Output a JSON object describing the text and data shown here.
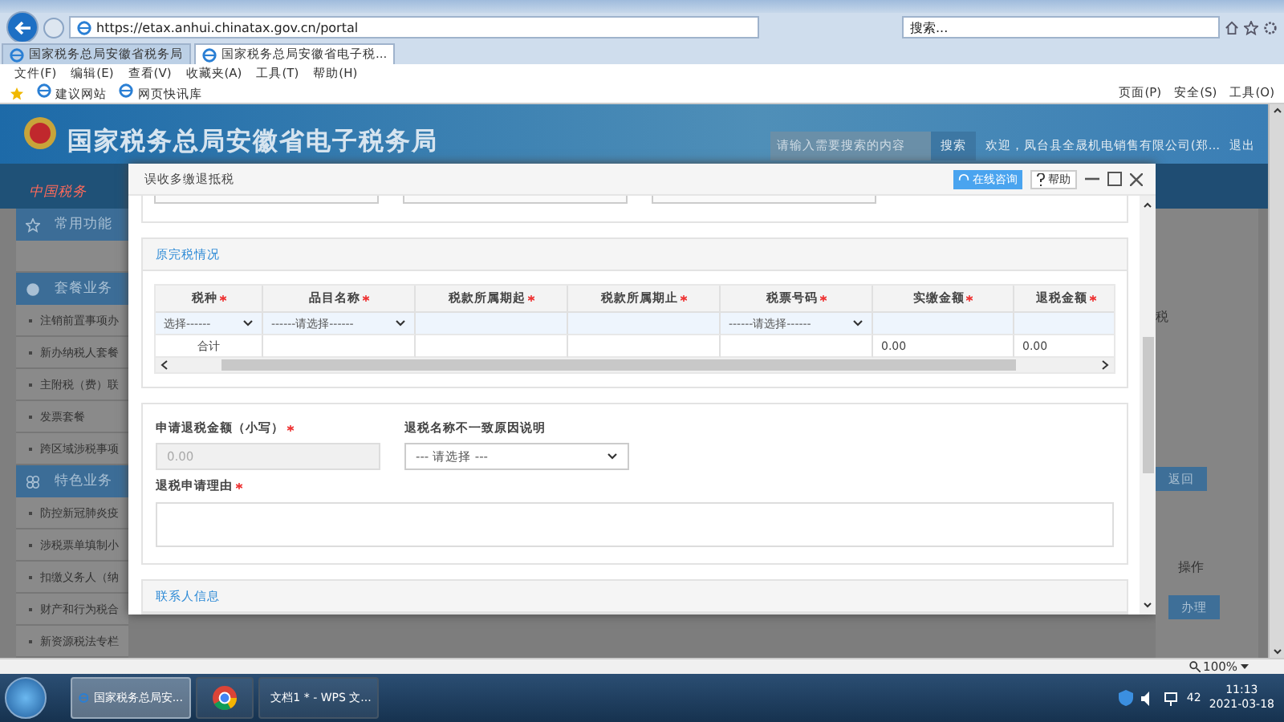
{
  "browser": {
    "url": "https://etax.anhui.chinatax.gov.cn/portal",
    "search_placeholder": "搜索...",
    "tabs": [
      {
        "label": "国家税务总局安徽省税务局",
        "selected": false
      },
      {
        "label": "国家税务总局安徽省电子税...",
        "selected": true
      }
    ],
    "menu": [
      "文件(F)",
      "编辑(E)",
      "查看(V)",
      "收藏夹(A)",
      "工具(T)",
      "帮助(H)"
    ],
    "favorites": [
      "建议网站",
      "网页快讯库"
    ],
    "commands": [
      "页面(P)",
      "安全(S)",
      "工具(O)"
    ]
  },
  "header": {
    "logo_text": "中国税务",
    "title": "国家税务总局安徽省电子税务局",
    "search": {
      "placeholder": "请输入需要搜索的内容",
      "button": "搜索"
    },
    "welcome": "欢迎，凤台县全晟机电销售有限公司(郑...",
    "logout": "退出"
  },
  "sidebar": {
    "sections": [
      {
        "title": "常用功能",
        "kind": "star"
      },
      {
        "title": "套餐业务",
        "kind": "globe",
        "items": [
          "注销前置事项办",
          "新办纳税人套餐",
          "主附税（费）联",
          "发票套餐",
          "跨区域涉税事项"
        ]
      },
      {
        "title": "特色业务",
        "kind": "clover",
        "items": [
          "防控新冠肺炎疫",
          "涉税票单填制小",
          "扣缴义务人（纳",
          "财产和行为税合",
          "新资源税法专栏"
        ]
      }
    ]
  },
  "background": {
    "side_text": "税",
    "back_button": "返回",
    "column_header": "操作",
    "action_button": "办理"
  },
  "dialog": {
    "title": "误收多缴退抵税",
    "consult_button": "在线咨询",
    "help_button": "帮助",
    "tax_section": {
      "title": "原完税情况",
      "columns": [
        {
          "label": "税种",
          "required": true
        },
        {
          "label": "品目名称",
          "required": true
        },
        {
          "label": "税款所属期起",
          "required": true
        },
        {
          "label": "税款所属期止",
          "required": true
        },
        {
          "label": "税票号码",
          "required": true
        },
        {
          "label": "实缴金额",
          "required": true
        },
        {
          "label": "退税金额",
          "required": true
        }
      ],
      "rows": [
        [
          {
            "kind": "select",
            "text": "选择------"
          },
          {
            "kind": "select",
            "text": "------请选择------"
          },
          {
            "kind": "input"
          },
          {
            "kind": "input"
          },
          {
            "kind": "select",
            "text": "------请选择------"
          },
          {
            "kind": "input"
          },
          {
            "kind": "input"
          }
        ],
        [
          {
            "kind": "text",
            "text": "合计"
          },
          {
            "kind": "blank"
          },
          {
            "kind": "blank"
          },
          {
            "kind": "blank"
          },
          {
            "kind": "blank"
          },
          {
            "kind": "text",
            "text": "0.00"
          },
          {
            "kind": "text",
            "text": "0.00"
          }
        ]
      ]
    },
    "refund_form": {
      "amount": {
        "label": "申请退税金额（小写）",
        "required": true,
        "value": "0.00",
        "disabled": true
      },
      "mismatch_reason": {
        "label": "退税名称不一致原因说明",
        "value": "--- 请选择 ---"
      },
      "reason": {
        "label": "退税申请理由",
        "required": true
      }
    },
    "contact_section": {
      "title": "联系人信息"
    }
  },
  "status_bar": {
    "zoom": "100%"
  },
  "taskbar": {
    "items": [
      {
        "kind": "ie",
        "label": "国家税务总局安...",
        "selected": true
      },
      {
        "kind": "chrome",
        "selected": false
      },
      {
        "kind": "wps",
        "label": "文档1 * - WPS 文...",
        "selected": false
      }
    ],
    "tray": {
      "badge": "42",
      "time": "11:13",
      "date": "2021-03-18"
    }
  }
}
